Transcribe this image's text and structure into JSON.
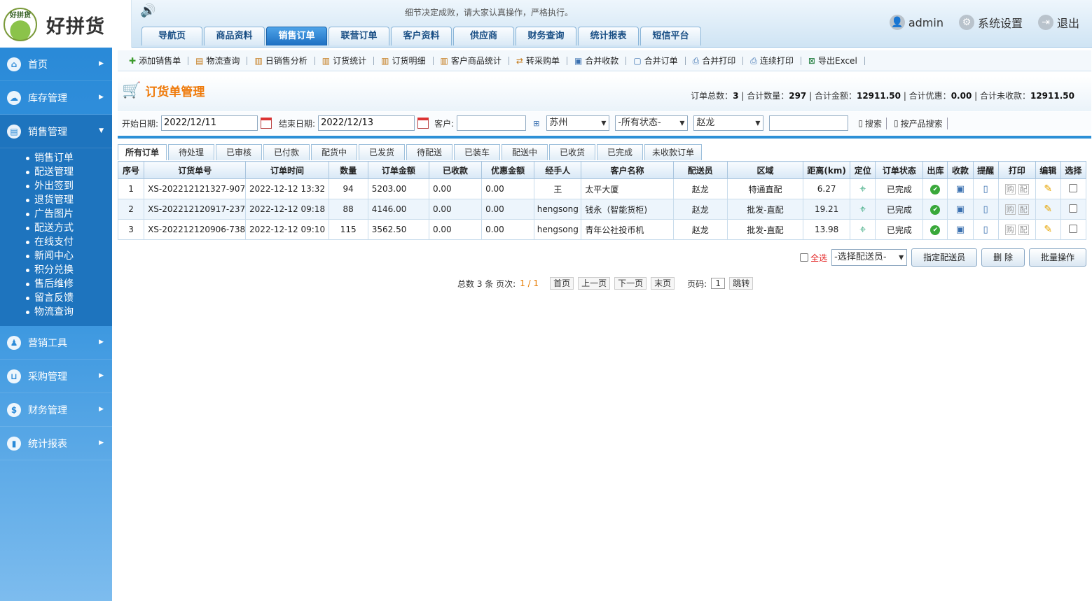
{
  "app": {
    "logo_mark": "好拼货",
    "logo_name": "好拼货",
    "notice": "细节决定成败，请大家认真操作，严格执行。"
  },
  "nav": [
    "导航页",
    "商品资料",
    "销售订单",
    "联营订单",
    "客户资料",
    "供应商",
    "财务查询",
    "统计报表",
    "短信平台"
  ],
  "user": {
    "name": "admin",
    "settings": "系统设置",
    "logout": "退出"
  },
  "sidebar": {
    "menus_top": [
      "首页",
      "库存管理",
      "销售管理"
    ],
    "submenu": [
      "销售订单",
      "配送管理",
      "外出签到",
      "退货管理",
      "广告图片",
      "配送方式",
      "在线支付",
      "新闻中心",
      "积分兑换",
      "售后维修",
      "留言反馈",
      "物流查询"
    ],
    "menus_bottom": [
      "营销工具",
      "采购管理",
      "财务管理",
      "统计报表"
    ]
  },
  "toolbar": [
    "添加销售单",
    "物流查询",
    "日销售分析",
    "订货统计",
    "订货明细",
    "客户商品统计",
    "转采购单",
    "合并收款",
    "合并订单",
    "合并打印",
    "连续打印",
    "导出Excel"
  ],
  "page": {
    "title": "订货单管理",
    "summary": {
      "l1": "订单总数：",
      "v1": "3",
      "l2": "合计数量：",
      "v2": "297",
      "l3": "合计金额：",
      "v3": "12911.50",
      "l4": "合计优惠：",
      "v4": "0.00",
      "l5": "合计未收款：",
      "v5": "12911.50"
    }
  },
  "filter": {
    "start_label": "开始日期:",
    "start": "2022/12/11",
    "end_label": "结束日期:",
    "end": "2022/12/13",
    "cust_label": "客户:",
    "city": "苏州",
    "status": "-所有状态-",
    "person": "赵龙",
    "search": "搜索",
    "product_search": "按产品搜索"
  },
  "tabs": [
    "所有订单",
    "待处理",
    "已审核",
    "已付款",
    "配货中",
    "已发货",
    "待配送",
    "已装车",
    "配送中",
    "已收货",
    "已完成",
    "未收款订单"
  ],
  "table": {
    "headers": [
      "序号",
      "订货单号",
      "订单时间",
      "数量",
      "订单金额",
      "已收款",
      "优惠金额",
      "经手人",
      "客户名称",
      "配送员",
      "区域",
      "距离(km)",
      "定位",
      "订单状态",
      "出库",
      "收款",
      "提醒",
      "打印",
      "编辑",
      "选择"
    ],
    "rows": [
      [
        "1",
        "XS-202212121327-907",
        "2022-12-12 13:32",
        "94",
        "5203.00",
        "0.00",
        "0.00",
        "王",
        "太平大厦",
        "赵龙",
        "特通直配",
        "6.27",
        "已完成"
      ],
      [
        "2",
        "XS-202212120917-237",
        "2022-12-12 09:18",
        "88",
        "4146.00",
        "0.00",
        "0.00",
        "hengsong",
        "钱永（智能货柜)",
        "赵龙",
        "批发-直配",
        "19.21",
        "已完成"
      ],
      [
        "3",
        "XS-202212120906-738",
        "2022-12-12 09:10",
        "115",
        "3562.50",
        "0.00",
        "0.00",
        "hengsong",
        "青年公社投币机",
        "赵龙",
        "批发-直配",
        "13.98",
        "已完成"
      ]
    ],
    "print_a": "购",
    "print_b": "配"
  },
  "batch": {
    "select_all": "全选",
    "courier": "-选择配送员-",
    "assign": "指定配送员",
    "delete": "删 除",
    "bulk": "批量操作"
  },
  "pager": {
    "text": "总数 3 条 页次:",
    "page": "1 / 1",
    "first": "首页",
    "prev": "上一页",
    "next": "下一页",
    "last": "末页",
    "pno_label": "页码:",
    "pno": "1",
    "go": "跳转"
  }
}
